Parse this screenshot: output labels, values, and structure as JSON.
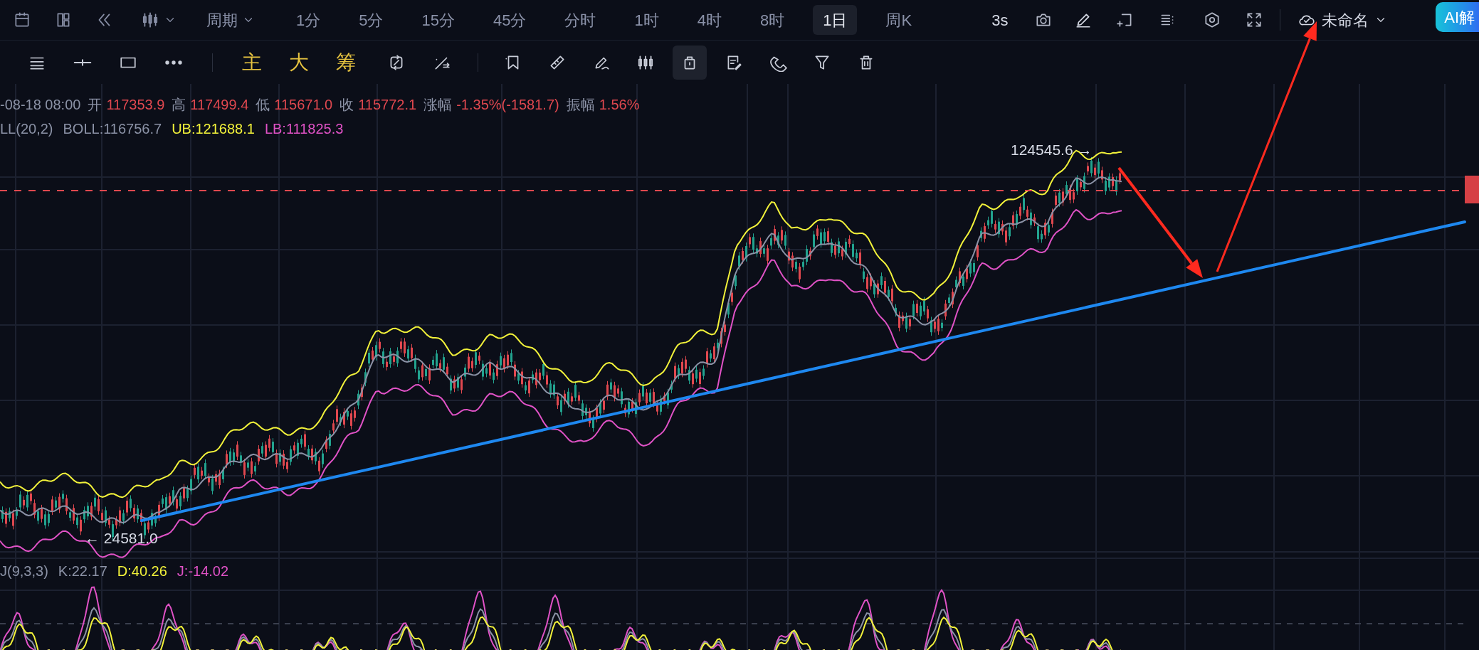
{
  "timeframes": [
    {
      "label": "1分",
      "selected": false
    },
    {
      "label": "5分",
      "selected": false
    },
    {
      "label": "15分",
      "selected": false
    },
    {
      "label": "45分",
      "selected": false
    },
    {
      "label": "分时",
      "selected": false
    },
    {
      "label": "1时",
      "selected": false
    },
    {
      "label": "4时",
      "selected": false
    },
    {
      "label": "8时",
      "selected": false
    },
    {
      "label": "1日",
      "selected": true
    },
    {
      "label": "周K",
      "selected": false
    }
  ],
  "period_menu": "周期",
  "refresh": "3s",
  "layout_name": "未命名",
  "ai_button": "AI解",
  "indicator_buttons": [
    "主",
    "大",
    "筹"
  ],
  "drawing_tools": [
    {
      "selected": false
    },
    {
      "selected": false
    },
    {
      "selected": false
    },
    {
      "selected": false
    },
    {
      "selected": true
    },
    {
      "selected": false
    },
    {
      "selected": false
    },
    {
      "selected": false
    },
    {
      "selected": false
    }
  ],
  "candle_info": {
    "time": "-08-18 08:00",
    "fields": [
      {
        "label": "开",
        "value": "117353.9"
      },
      {
        "label": "高",
        "value": "117499.4"
      },
      {
        "label": "低",
        "value": "115671.0"
      },
      {
        "label": "收",
        "value": "115772.1"
      },
      {
        "label": "涨幅",
        "value": "-1.35%(-1581.7)"
      },
      {
        "label": "振幅",
        "value": "1.56%"
      }
    ]
  },
  "boll_legend": [
    {
      "text": "LL(20,2)",
      "color": "#8b92a6"
    },
    {
      "text": "BOLL:116756.7",
      "color": "#8b92a6"
    },
    {
      "text": "UB:121688.1",
      "color": "#f2f23a"
    },
    {
      "text": "LB:111825.3",
      "color": "#e052c6"
    }
  ],
  "price_labels": {
    "high": "124545.6 →",
    "low": "← 24581.0"
  },
  "kdj_legend": [
    {
      "text": "J(9,3,3)",
      "color": "#8b92a6"
    },
    {
      "text": "K:22.17",
      "color": "#8b92a6"
    },
    {
      "text": "D:40.26",
      "color": "#f2f23a"
    },
    {
      "text": "J:-14.02",
      "color": "#e052c6"
    }
  ]
}
